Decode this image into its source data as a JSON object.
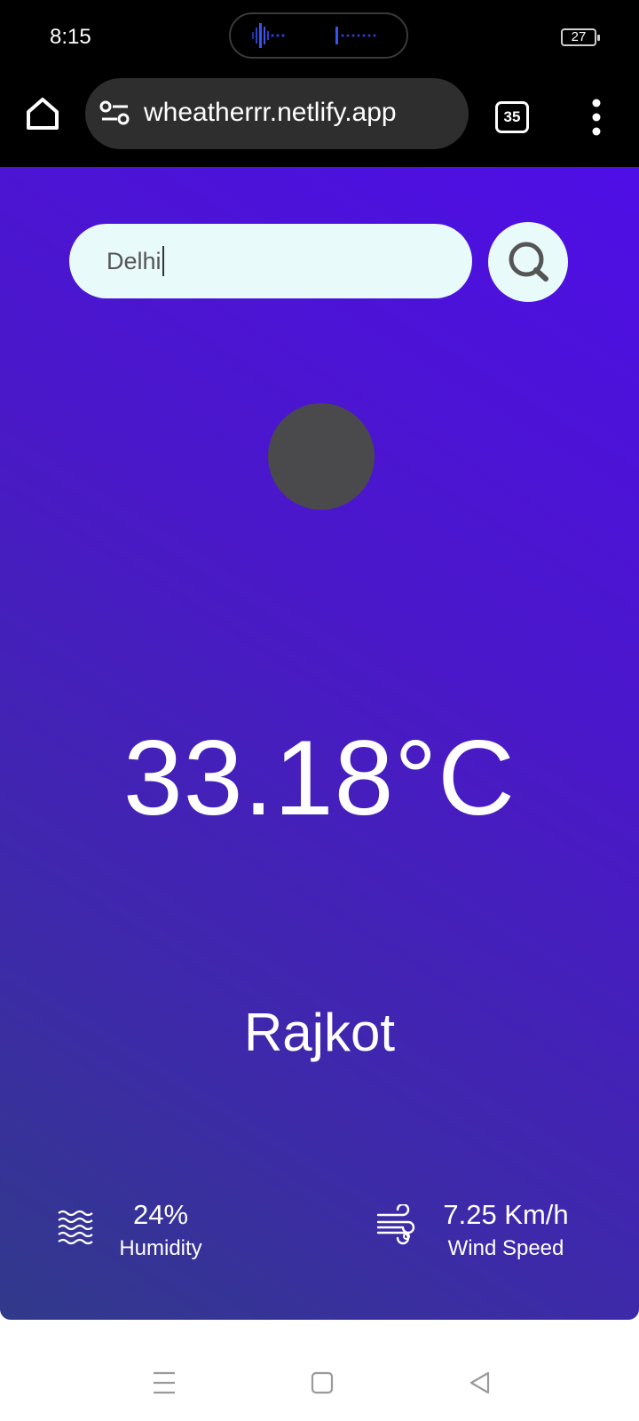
{
  "status_bar": {
    "time": "8:15",
    "battery_level": "27"
  },
  "browser": {
    "url": "wheatherrr.netlify.app",
    "tab_count": "35"
  },
  "app": {
    "search": {
      "value": "Delhi",
      "placeholder": ""
    },
    "temperature": "33.18°C",
    "city": "Rajkot",
    "humidity": {
      "value": "24%",
      "label": "Humidity"
    },
    "wind": {
      "value": "7.25 Km/h",
      "label": "Wind Speed"
    }
  },
  "icons": {
    "home": "home-icon",
    "site_info": "tune-icon",
    "menu": "more-vert-icon",
    "search": "magnifier-icon",
    "weather": "weather-icon",
    "humidity": "waves-icon",
    "wind": "wind-icon"
  },
  "colors": {
    "card_gradient_top": "#4e0ee6",
    "card_gradient_bottom": "#313a8a",
    "input_bg": "#e8fbfa",
    "weather_icon_placeholder": "#4a4a4c"
  }
}
